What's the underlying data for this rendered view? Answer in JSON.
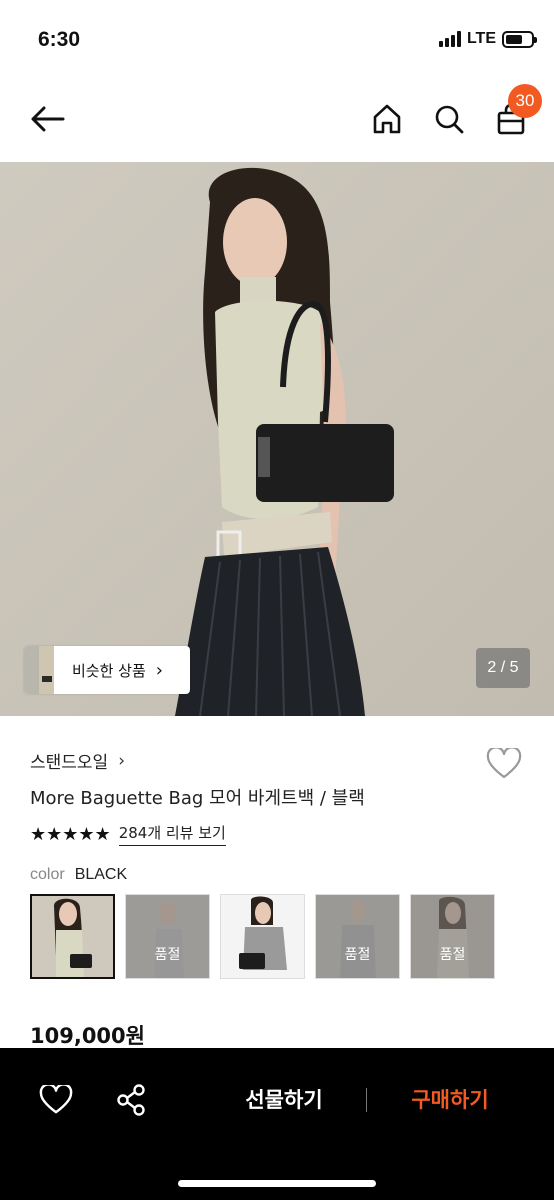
{
  "status_bar": {
    "time": "6:30",
    "network": "LTE",
    "battery_level": 0.65
  },
  "nav": {
    "back_icon": "arrow-left-icon",
    "home_icon": "home-icon",
    "search_icon": "search-icon",
    "cart_icon": "shopping-bag-icon",
    "cart_count": "30"
  },
  "colors": {
    "accent": "#f25a22",
    "bottom_bar": "#000000"
  },
  "gallery": {
    "similar_label": "비슷한 상품",
    "similar_chevron": "›",
    "page_indicator": "2 / 5"
  },
  "product": {
    "brand": "스탠드오일",
    "brand_chevron": "›",
    "name": "More Baguette Bag 모어 바게트백 / 블랙",
    "stars": "★★★★★",
    "rating": 5,
    "review_link": "284개 리뷰 보기",
    "color_label": "color",
    "color_value": "BLACK",
    "swatches": [
      {
        "selected": true,
        "soldout": ""
      },
      {
        "selected": false,
        "soldout": "품절"
      },
      {
        "selected": false,
        "soldout": ""
      },
      {
        "selected": false,
        "soldout": "품절"
      },
      {
        "selected": false,
        "soldout": "품절"
      }
    ],
    "price": "109,000원"
  },
  "bottom_bar": {
    "wish_icon": "heart-icon",
    "share_icon": "share-icon",
    "gift_label": "선물하기",
    "buy_label": "구매하기"
  }
}
